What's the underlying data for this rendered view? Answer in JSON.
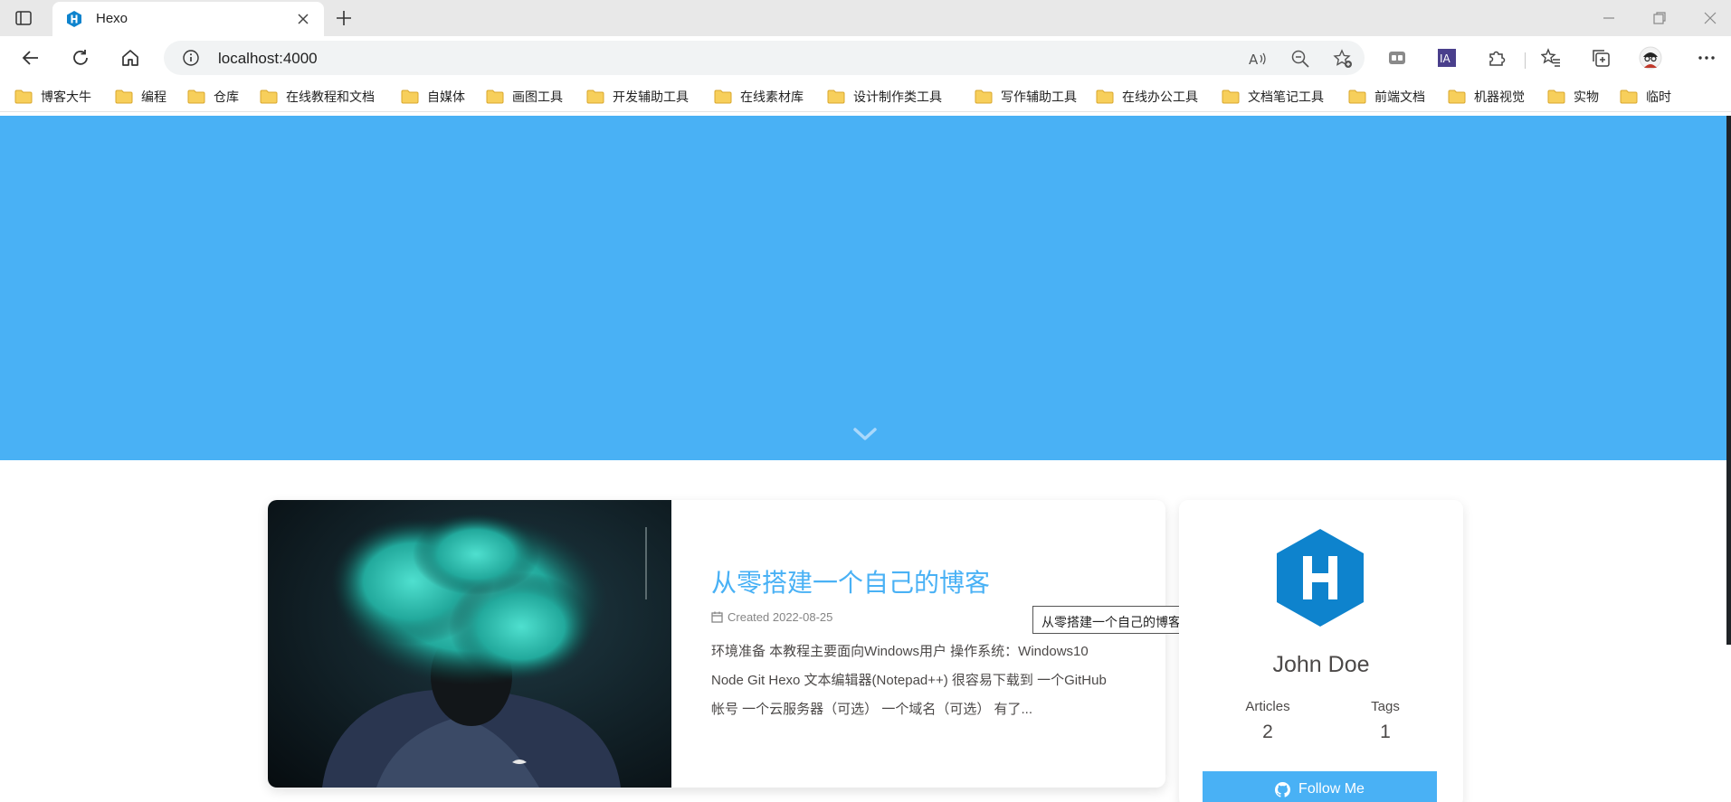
{
  "browser": {
    "tab": {
      "title": "Hexo",
      "favicon": "hexo-icon"
    },
    "address": {
      "url": "localhost:4000"
    },
    "bookmarks": [
      "博客大牛",
      "编程",
      "仓库",
      "在线教程和文档",
      "自媒体",
      "画图工具",
      "开发辅助工具",
      "在线素材库",
      "设计制作类工具",
      "写作辅助工具",
      "在线办公工具",
      "文档笔记工具",
      "前端文档",
      "机器视觉",
      "实物",
      "临时"
    ],
    "extensions": [
      "tab-manager-icon",
      "ia-extension-icon",
      "puzzle-icon"
    ]
  },
  "colors": {
    "accent": "#49b1f5",
    "hexo_logo": "#0e83cd",
    "text": "#4c4948"
  },
  "post": {
    "title": "从零搭建一个自己的博客",
    "meta": "Created 2022-08-25",
    "excerpt": "环境准备 本教程主要面向Windows用户 操作系统：Windows10 Node Git Hexo 文本编辑器(Notepad++) 很容易下载到 一个GitHub 帐号 一个云服务器（可选） 一个域名（可选） 有了..."
  },
  "tooltip": "从零搭建一个自己的博客",
  "author": {
    "name": "John Doe",
    "stats": [
      {
        "label": "Articles",
        "value": "2"
      },
      {
        "label": "Tags",
        "value": "1"
      }
    ],
    "follow_label": "Follow Me"
  }
}
